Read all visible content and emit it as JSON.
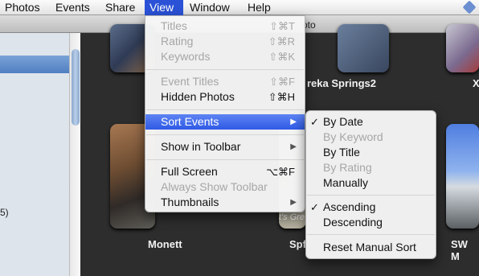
{
  "menubar": {
    "items": [
      "Photos",
      "Events",
      "Share",
      "View",
      "Window",
      "Help"
    ],
    "active": "View"
  },
  "window_title_fragment": "oto",
  "sidebar": {
    "count_fragment": "5)"
  },
  "events": [
    {
      "label": "reka Springs2"
    },
    {
      "label": "X"
    },
    {
      "label": "Monett"
    },
    {
      "label": "Spf"
    },
    {
      "label": "SW M"
    },
    {
      "label": "t's Gre"
    }
  ],
  "view_menu": {
    "items": [
      {
        "label": "Titles",
        "shortcut": "⇧⌘T",
        "enabled": false
      },
      {
        "label": "Rating",
        "shortcut": "⇧⌘R",
        "enabled": false
      },
      {
        "label": "Keywords",
        "shortcut": "⇧⌘K",
        "enabled": false
      },
      {
        "label": "Event Titles",
        "shortcut": "⇧⌘F",
        "enabled": false
      },
      {
        "label": "Hidden Photos",
        "shortcut": "⇧⌘H",
        "enabled": true
      },
      {
        "label": "Sort Events",
        "submenu_arrow": "▶",
        "enabled": true,
        "highlighted": true
      },
      {
        "label": "Show in Toolbar",
        "submenu_arrow": "▶",
        "enabled": true
      },
      {
        "label": "Full Screen",
        "shortcut": "⌥⌘F",
        "enabled": true
      },
      {
        "label": "Always Show Toolbar",
        "enabled": false
      },
      {
        "label": "Thumbnails",
        "submenu_arrow": "▶",
        "enabled": true
      }
    ]
  },
  "sort_submenu": {
    "check_glyph": "✓",
    "items": [
      {
        "label": "By Date",
        "checked": true,
        "enabled": true
      },
      {
        "label": "By Keyword",
        "enabled": false
      },
      {
        "label": "By Title",
        "enabled": true
      },
      {
        "label": "By Rating",
        "enabled": false
      },
      {
        "label": "Manually",
        "enabled": true
      },
      {
        "label": "Ascending",
        "checked": true,
        "enabled": true
      },
      {
        "label": "Descending",
        "enabled": true
      },
      {
        "label": "Reset Manual Sort",
        "enabled": true
      }
    ]
  },
  "colors": {
    "highlight": "#2f5ae5",
    "menubar_active": "#2b52d6",
    "disabled_text": "#a6a6a6"
  }
}
